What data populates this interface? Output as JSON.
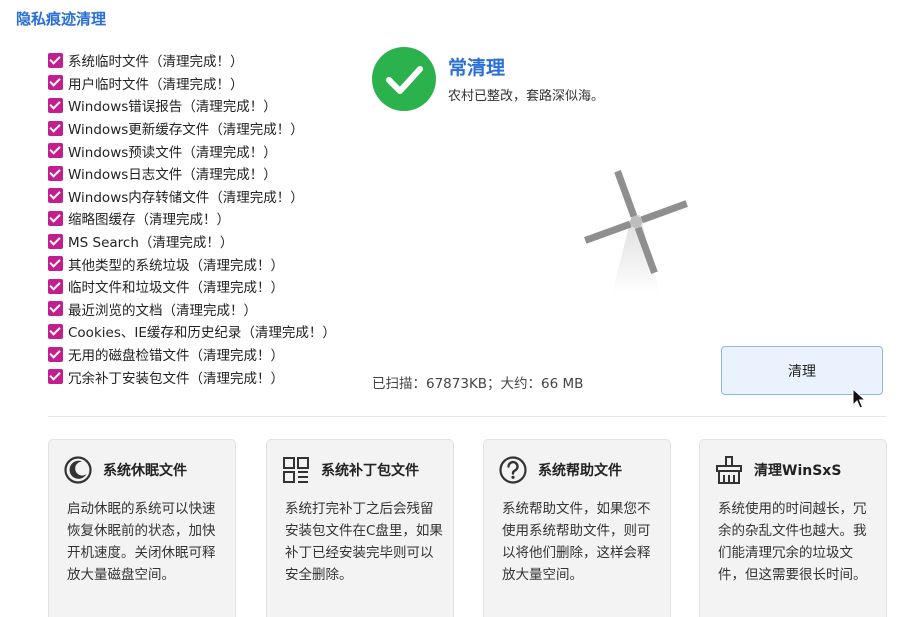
{
  "header": {
    "title": "隐私痕迹清理"
  },
  "items": [
    "系统临时文件（清理完成！）",
    "用户临时文件（清理完成！）",
    "Windows错误报告（清理完成！）",
    "Windows更新缓存文件（清理完成！）",
    "Windows预读文件（清理完成！）",
    "Windows日志文件（清理完成！）",
    "Windows内存转储文件（清理完成！）",
    "缩略图缓存（清理完成！）",
    "MS Search（清理完成！）",
    "其他类型的系统垃圾（清理完成！）",
    "临时文件和垃圾文件（清理完成！）",
    "最近浏览的文档（清理完成！）",
    "Cookies、IE缓存和历史纪录（清理完成！）",
    "无用的磁盘检错文件（清理完成！）",
    "冗余补丁安装包文件（清理完成！）"
  ],
  "status": {
    "title": "常清理",
    "subtitle": "农村已整改，套路深似海。",
    "icon": "check-circle-icon",
    "color": "#2bb24c"
  },
  "scan": {
    "text": "已扫描：67873KB；大约：66 MB"
  },
  "button": {
    "label": "清理"
  },
  "cards": [
    {
      "icon": "moon-icon",
      "title": "系统休眠文件",
      "desc": "启动休眠的系统可以快速恢复休眠前的状态，加快开机速度。关闭休眠可释放大量磁盘空间。"
    },
    {
      "icon": "grid-icon",
      "title": "系统补丁包文件",
      "desc": "系统打完补丁之后会残留安装包文件在C盘里，如果补丁已经安装完毕则可以安全删除。"
    },
    {
      "icon": "question-icon",
      "title": "系统帮助文件",
      "desc": "系统帮助文件，如果您不使用系统帮助文件，则可以将他们删除，这样会释放大量空间。"
    },
    {
      "icon": "broom-icon",
      "title": "清理WinSxS",
      "desc": "系统使用的时间越长，冗余的杂乱文件也越大。我们能清理冗余的垃圾文件，但这需要很长时间。"
    }
  ],
  "colors": {
    "accent": "#2a6fd6",
    "checkbox": "#c21e8f",
    "success": "#2bb24c"
  }
}
